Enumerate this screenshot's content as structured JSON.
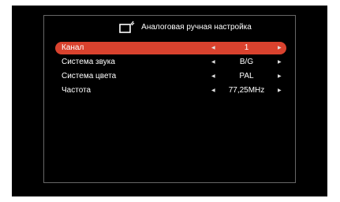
{
  "title": "Аналоговая ручная настройка",
  "icons": {
    "title_icon": "tv-antenna-icon",
    "left_arrow": "left-triangle-icon",
    "right_arrow": "right-triangle-icon"
  },
  "colors": {
    "selected_row": "#d9422e",
    "background": "#000000",
    "panel_border": "#666666"
  },
  "rows": [
    {
      "label": "Канал",
      "value": "1",
      "selected": true
    },
    {
      "label": "Система звука",
      "value": "B/G",
      "selected": false
    },
    {
      "label": "Система цвета",
      "value": "PAL",
      "selected": false
    },
    {
      "label": "Частота",
      "value": "77,25MHz",
      "selected": false
    }
  ]
}
